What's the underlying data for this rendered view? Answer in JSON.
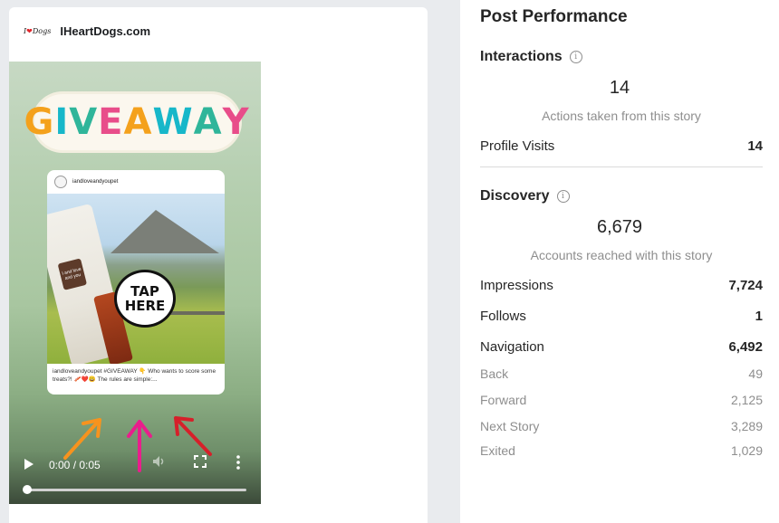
{
  "brand": {
    "logo_text": "I",
    "logo_tail": "Dogs",
    "name": "IHeartDogs.com"
  },
  "story": {
    "giveaway_letters": [
      "G",
      "I",
      "V",
      "E",
      "A",
      "W",
      "A",
      "Y"
    ],
    "post_username": "iandloveandyoupet",
    "bag_label": "I and love and you",
    "tap_line1": "TAP",
    "tap_line2": "HERE",
    "caption": "iandloveandyoupet #GIVEAWAY 👇 Who wants to score some treats?! 🥓❤️😀 The rules are simple:...",
    "arrow_colors": [
      "#f7931e",
      "#e91e8c",
      "#d6202a"
    ]
  },
  "player": {
    "time": "0:00 / 0:05",
    "progress_fraction": 0.0,
    "icons": [
      "play-icon",
      "volume-icon",
      "fullscreen-icon",
      "more-options-icon"
    ]
  },
  "performance": {
    "title": "Post Performance",
    "interactions": {
      "title": "Interactions",
      "value": "14",
      "caption": "Actions taken from this story",
      "rows": [
        {
          "label": "Profile Visits",
          "value": "14"
        }
      ]
    },
    "discovery": {
      "title": "Discovery",
      "value": "6,679",
      "caption": "Accounts reached with this story",
      "rows": [
        {
          "label": "Impressions",
          "value": "7,724"
        },
        {
          "label": "Follows",
          "value": "1"
        },
        {
          "label": "Navigation",
          "value": "6,492"
        }
      ],
      "navigation_rows": [
        {
          "label": "Back",
          "value": "49"
        },
        {
          "label": "Forward",
          "value": "2,125"
        },
        {
          "label": "Next Story",
          "value": "3,289"
        },
        {
          "label": "Exited",
          "value": "1,029"
        }
      ]
    }
  }
}
